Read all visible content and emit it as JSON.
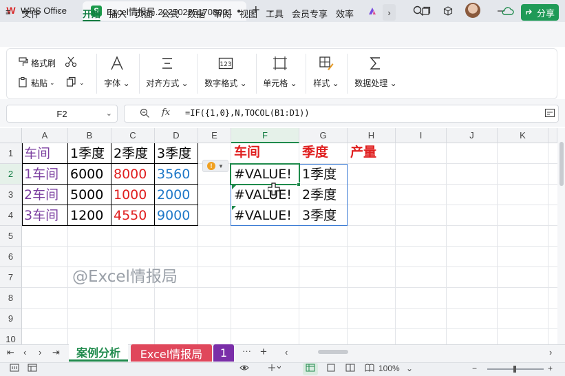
{
  "titlebar": {
    "app_name": "WPS Office",
    "doc_tab": "Excel情报局.2025022517080013",
    "new_tab": "+"
  },
  "menubar": {
    "file": "文件",
    "more": "···",
    "tabs": [
      "开始",
      "插入",
      "页面",
      "公式",
      "数据",
      "审阅",
      "视图",
      "工具",
      "会员专享",
      "效率"
    ],
    "share": "分享"
  },
  "ribbon": {
    "format_painter": "格式刷",
    "paste": "粘贴",
    "font": "字体",
    "align": "对齐方式",
    "number_format": "数字格式",
    "cell": "单元格",
    "style": "样式",
    "data_processing": "数据处理"
  },
  "formula_bar": {
    "name_box": "F2",
    "fx": "fx",
    "formula": "=IF({1,0},N,TOCOL(B1:D1))"
  },
  "grid": {
    "columns": [
      "A",
      "B",
      "C",
      "D",
      "E",
      "F",
      "G",
      "H",
      "I",
      "J",
      "K"
    ],
    "rows": [
      "1",
      "2",
      "3",
      "4",
      "5",
      "6",
      "7",
      "8",
      "9",
      "10"
    ],
    "source_table": [
      [
        "车间",
        "1季度",
        "2季度",
        "3季度"
      ],
      [
        "1车间",
        "6000",
        "8000",
        "3560"
      ],
      [
        "2车间",
        "5000",
        "1000",
        "2000"
      ],
      [
        "3车间",
        "1200",
        "4550",
        "9000"
      ]
    ],
    "result_headers": [
      "车间",
      "季度",
      "产量"
    ],
    "result_col_f": [
      "#VALUE!",
      "#VALUE!",
      "#VALUE!"
    ],
    "result_col_g": [
      "1季度",
      "2季度",
      "3季度"
    ],
    "watermark": "@Excel情报局"
  },
  "colors": {
    "workshop": "#7b3fa0",
    "q1": "#000000",
    "q2": "#e02020",
    "q3": "#1e78c8",
    "header_red": "#e02020",
    "accent_green": "#1f8a4c"
  },
  "sheets": {
    "tabs": [
      "案例分析",
      "Excel情报局",
      "1"
    ],
    "more": "···",
    "add": "+"
  },
  "statusbar": {
    "zoom": "100%"
  }
}
